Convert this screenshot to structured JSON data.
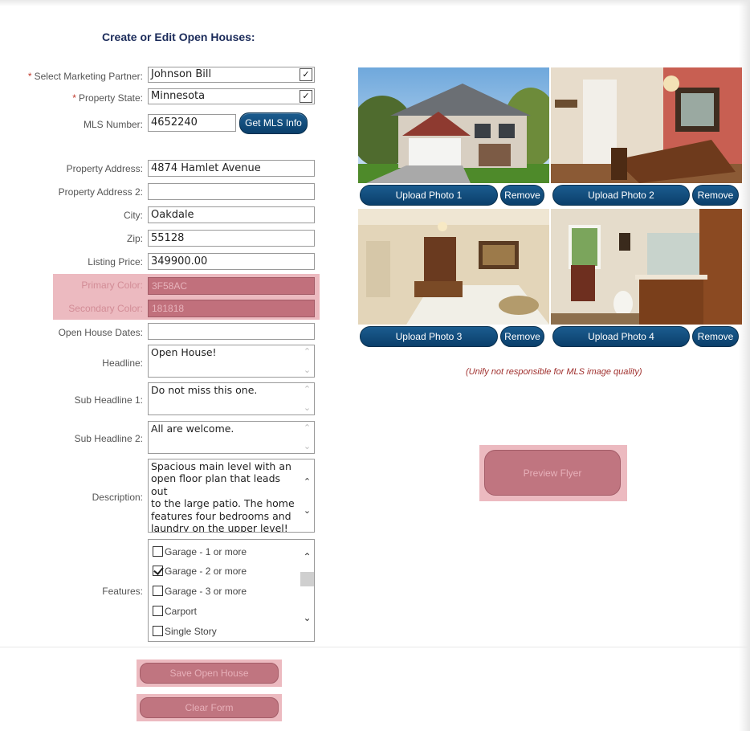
{
  "page": {
    "title": "Create or Edit Open Houses:"
  },
  "form": {
    "marketing_partner": {
      "label": "Select Marketing Partner:",
      "value": "Johnson Bill"
    },
    "property_state": {
      "label": "Property State:",
      "value": "Minnesota"
    },
    "mls_number": {
      "label": "MLS Number:",
      "value": "4652240",
      "button": "Get MLS Info"
    },
    "address": {
      "label": "Property Address:",
      "value": "4874 Hamlet Avenue"
    },
    "address2": {
      "label": "Property Address 2:",
      "value": ""
    },
    "city": {
      "label": "City:",
      "value": "Oakdale"
    },
    "zip": {
      "label": "Zip:",
      "value": "55128"
    },
    "price": {
      "label": "Listing Price:",
      "value": "349900.00"
    },
    "primary_color": {
      "label": "Primary Color:",
      "value": "3F58AC"
    },
    "secondary_color": {
      "label": "Secondary Color:",
      "value": "181818"
    },
    "dates": {
      "label": "Open House Dates:",
      "value": ""
    },
    "headline": {
      "label": "Headline:",
      "value": "Open House!"
    },
    "subheadline1": {
      "label": "Sub Headline 1:",
      "value": "Do not miss this one."
    },
    "subheadline2": {
      "label": "Sub Headline 2:",
      "value": "All are welcome."
    },
    "description": {
      "label": "Description:",
      "lines": [
        "Spacious main level with an",
        "open floor plan that leads out",
        "to the large patio. The home",
        "features four bedrooms and",
        "laundry on the upper level!"
      ]
    },
    "features": {
      "label": "Features:",
      "items": [
        {
          "label": "Garage - 1 or more",
          "checked": false
        },
        {
          "label": "Garage - 2 or more",
          "checked": true
        },
        {
          "label": "Garage - 3 or more",
          "checked": false
        },
        {
          "label": "Carport",
          "checked": false
        },
        {
          "label": "Single Story",
          "checked": false
        }
      ]
    },
    "required_mark": "*"
  },
  "actions": {
    "save": "Save Open House",
    "clear": "Clear Form",
    "preview": "Preview Flyer"
  },
  "photos": {
    "upload_labels": [
      "Upload Photo 1",
      "Upload Photo 2",
      "Upload Photo 3",
      "Upload Photo 4"
    ],
    "remove_label": "Remove",
    "disclaimer": "(Unify not responsible for MLS image quality)"
  },
  "colors": {
    "button_blue": "#0b3f6b",
    "highlight_pink": "#c07580",
    "title_navy": "#1b2b5a",
    "disclaimer_red": "#a0302e"
  }
}
